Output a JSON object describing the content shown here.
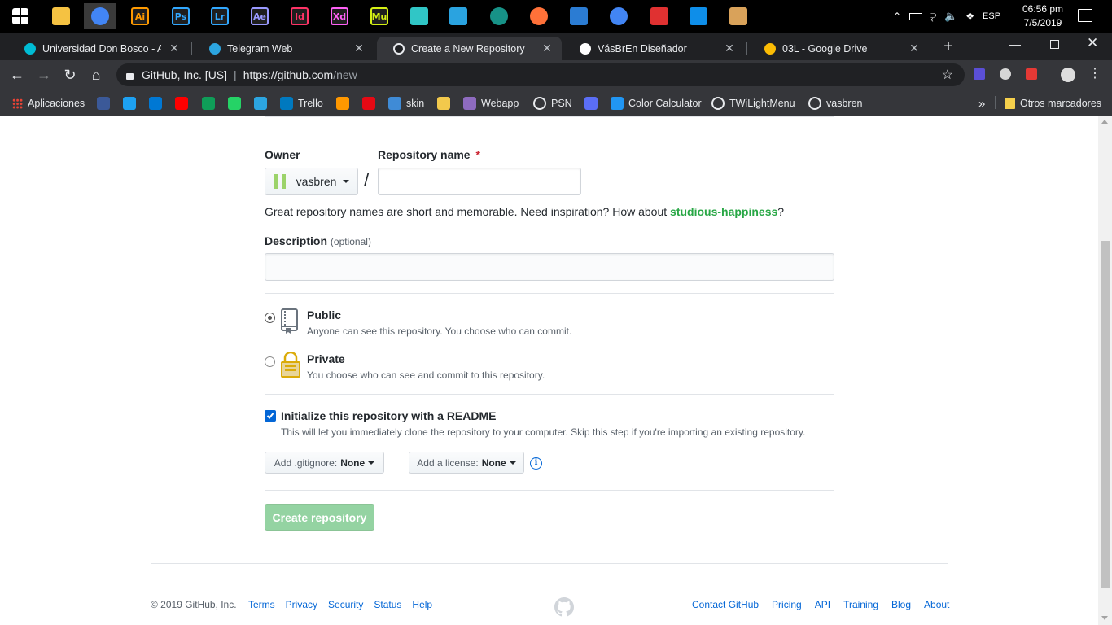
{
  "taskbar": {
    "apps": [
      {
        "name": "windows-start-icon",
        "label": "",
        "color": "#ffffff"
      },
      {
        "name": "file-explorer-icon",
        "label": "",
        "color": "#f5c242"
      },
      {
        "name": "chrome-icon",
        "label": "",
        "color": "#4285f4"
      },
      {
        "name": "illustrator-icon",
        "label": "Ai",
        "color": "#ff9a00"
      },
      {
        "name": "photoshop-icon",
        "label": "Ps",
        "color": "#31a8ff"
      },
      {
        "name": "lightroom-icon",
        "label": "Lr",
        "color": "#31a8ff"
      },
      {
        "name": "after-effects-icon",
        "label": "Ae",
        "color": "#9999ff"
      },
      {
        "name": "indesign-icon",
        "label": "Id",
        "color": "#ff3366"
      },
      {
        "name": "xd-icon",
        "label": "Xd",
        "color": "#ff61f6"
      },
      {
        "name": "muse-icon",
        "label": "Mu",
        "color": "#d5f014"
      },
      {
        "name": "teal-app-icon",
        "label": "",
        "color": "#30c6c6"
      },
      {
        "name": "blue-app-icon",
        "label": "",
        "color": "#2aa3e0"
      },
      {
        "name": "gitkraken-icon",
        "label": "",
        "color": "#179287"
      },
      {
        "name": "firefox-icon",
        "label": "",
        "color": "#ff7139"
      },
      {
        "name": "word-document-icon",
        "label": "",
        "color": "#2b7cd3"
      },
      {
        "name": "chrome-icon-2",
        "label": "",
        "color": "#4285f4"
      },
      {
        "name": "acrobat-icon",
        "label": "",
        "color": "#e03131"
      },
      {
        "name": "teamviewer-icon",
        "label": "",
        "color": "#0e8ee9"
      },
      {
        "name": "paint-icon",
        "label": "",
        "color": "#d9a25a"
      }
    ],
    "language": "ESP",
    "time": "06:56 pm",
    "date": "7/5/2019"
  },
  "tabs": [
    {
      "title": "Universidad Don Bosco - Aula",
      "color": "#00bcd4",
      "active": false
    },
    {
      "title": "Telegram Web",
      "color": "#2ca5e0",
      "active": false
    },
    {
      "title": "Create a New Repository",
      "color": "#ffffff",
      "active": true
    },
    {
      "title": "VásBrEn Diseñador",
      "color": "#ffffff",
      "active": false
    },
    {
      "title": "03L - Google Drive",
      "color": "#fbbc04",
      "active": false
    }
  ],
  "new_tab": "+",
  "url": {
    "site": "GitHub, Inc. [US]",
    "host": "https://github.com",
    "path": "/new"
  },
  "bookmarks": {
    "apps_label": "Aplicaciones",
    "items": [
      {
        "label": "",
        "color": "#3b5998"
      },
      {
        "label": "",
        "color": "#1da1f2"
      },
      {
        "label": "",
        "color": "#0078d4"
      },
      {
        "label": "",
        "color": "#ff0000"
      },
      {
        "label": "",
        "color": "#0f9d58"
      },
      {
        "label": "",
        "color": "#25d366"
      },
      {
        "label": "",
        "color": "#2ca5e0"
      },
      {
        "label": "Trello",
        "color": "#0079bf"
      },
      {
        "label": "",
        "color": "#ff9800"
      },
      {
        "label": "",
        "color": "#e50914"
      },
      {
        "label": "skin",
        "color": "#3f8bd6"
      },
      {
        "label": "",
        "color": "#f2c94c"
      },
      {
        "label": "Webapp",
        "color": "#8e6bbf"
      },
      {
        "label": "PSN",
        "color": "#ffffff"
      },
      {
        "label": "",
        "color": "#5b6ef5"
      },
      {
        "label": "Color Calculator",
        "color": "#2196f3"
      },
      {
        "label": "TWiLightMenu",
        "color": "#333333"
      },
      {
        "label": "vasbren",
        "color": "#333333"
      }
    ],
    "overflow": "»",
    "other": "Otros marcadores"
  },
  "form": {
    "owner_label": "Owner",
    "owner": "vasbren",
    "slash": "/",
    "repo_label": "Repository name",
    "required_mark": "*",
    "repo_value": "",
    "hint_prefix": "Great repository names are short and memorable. Need inspiration? How about ",
    "hint_suggestion": "studious-happiness",
    "hint_suffix": "?",
    "desc_label": "Description",
    "desc_optional": "(optional)",
    "desc_value": "",
    "public_title": "Public",
    "public_desc": "Anyone can see this repository. You choose who can commit.",
    "private_title": "Private",
    "private_desc": "You choose who can see and commit to this repository.",
    "visibility_selected": "public",
    "readme_label": "Initialize this repository with a README",
    "readme_desc": "This will let you immediately clone the repository to your computer. Skip this step if you're importing an existing repository.",
    "readme_checked": true,
    "gitignore_prefix": "Add .gitignore:",
    "gitignore_value": "None",
    "license_prefix": "Add a license:",
    "license_value": "None",
    "submit_label": "Create repository"
  },
  "footer": {
    "copyright": "© 2019 GitHub, Inc.",
    "left_links": [
      "Terms",
      "Privacy",
      "Security",
      "Status",
      "Help"
    ],
    "right_links": [
      "Contact GitHub",
      "Pricing",
      "API",
      "Training",
      "Blog",
      "About"
    ]
  }
}
